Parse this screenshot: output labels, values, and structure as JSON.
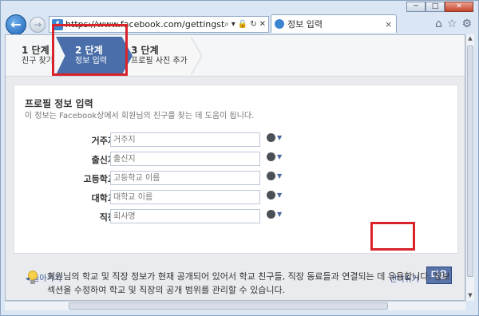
{
  "browser": {
    "url": "https://www.facebook.com/gettingstarted/?_r",
    "tab_title": "정보 입력",
    "minimize": "─",
    "maximize": "□",
    "close": "✕",
    "back_glyph": "←",
    "forward_glyph": "→",
    "tab_close": "×",
    "address_tools": [
      "⌕",
      "▾",
      "🔒",
      "↻",
      "✕"
    ],
    "tool_icons": [
      "⌂",
      "☆",
      "⚙"
    ]
  },
  "steps": [
    {
      "title": "1 단계",
      "subtitle": "친구 찾기"
    },
    {
      "title": "2 단계",
      "subtitle": "정보 입력"
    },
    {
      "title": "3 단계",
      "subtitle": "프로필 사진 추가"
    }
  ],
  "panel": {
    "title": "프로필 정보 입력",
    "description": "이 정보는 Facebook상에서 회원님의 친구를 찾는 데 도움이 됩니다.",
    "fields": [
      {
        "label": "거주지",
        "placeholder": "거주지"
      },
      {
        "label": "출신지",
        "placeholder": "출신지"
      },
      {
        "label": "고등학교",
        "placeholder": "고등학교 이름"
      },
      {
        "label": "대학교",
        "placeholder": "대학교 이름"
      },
      {
        "label": "직장",
        "placeholder": "회사명"
      }
    ],
    "back_link": "◂ 돌아가기",
    "skip_link": "건너뛰기",
    "next_button": "다음"
  },
  "info": {
    "text": "회원님의 학교 및 직장 정보가 현재 공개되어 있어서 학교 친구들, 직장 동료들과 연결되는 데 유용합니다. 정보 섹션을 수정하여 학교 및 직장의 공개 범위를 관리할 수 있습니다."
  },
  "colors": {
    "facebook_blue": "#3b5998",
    "active_step": "#4a6ea9",
    "highlight": "#d9232b"
  }
}
